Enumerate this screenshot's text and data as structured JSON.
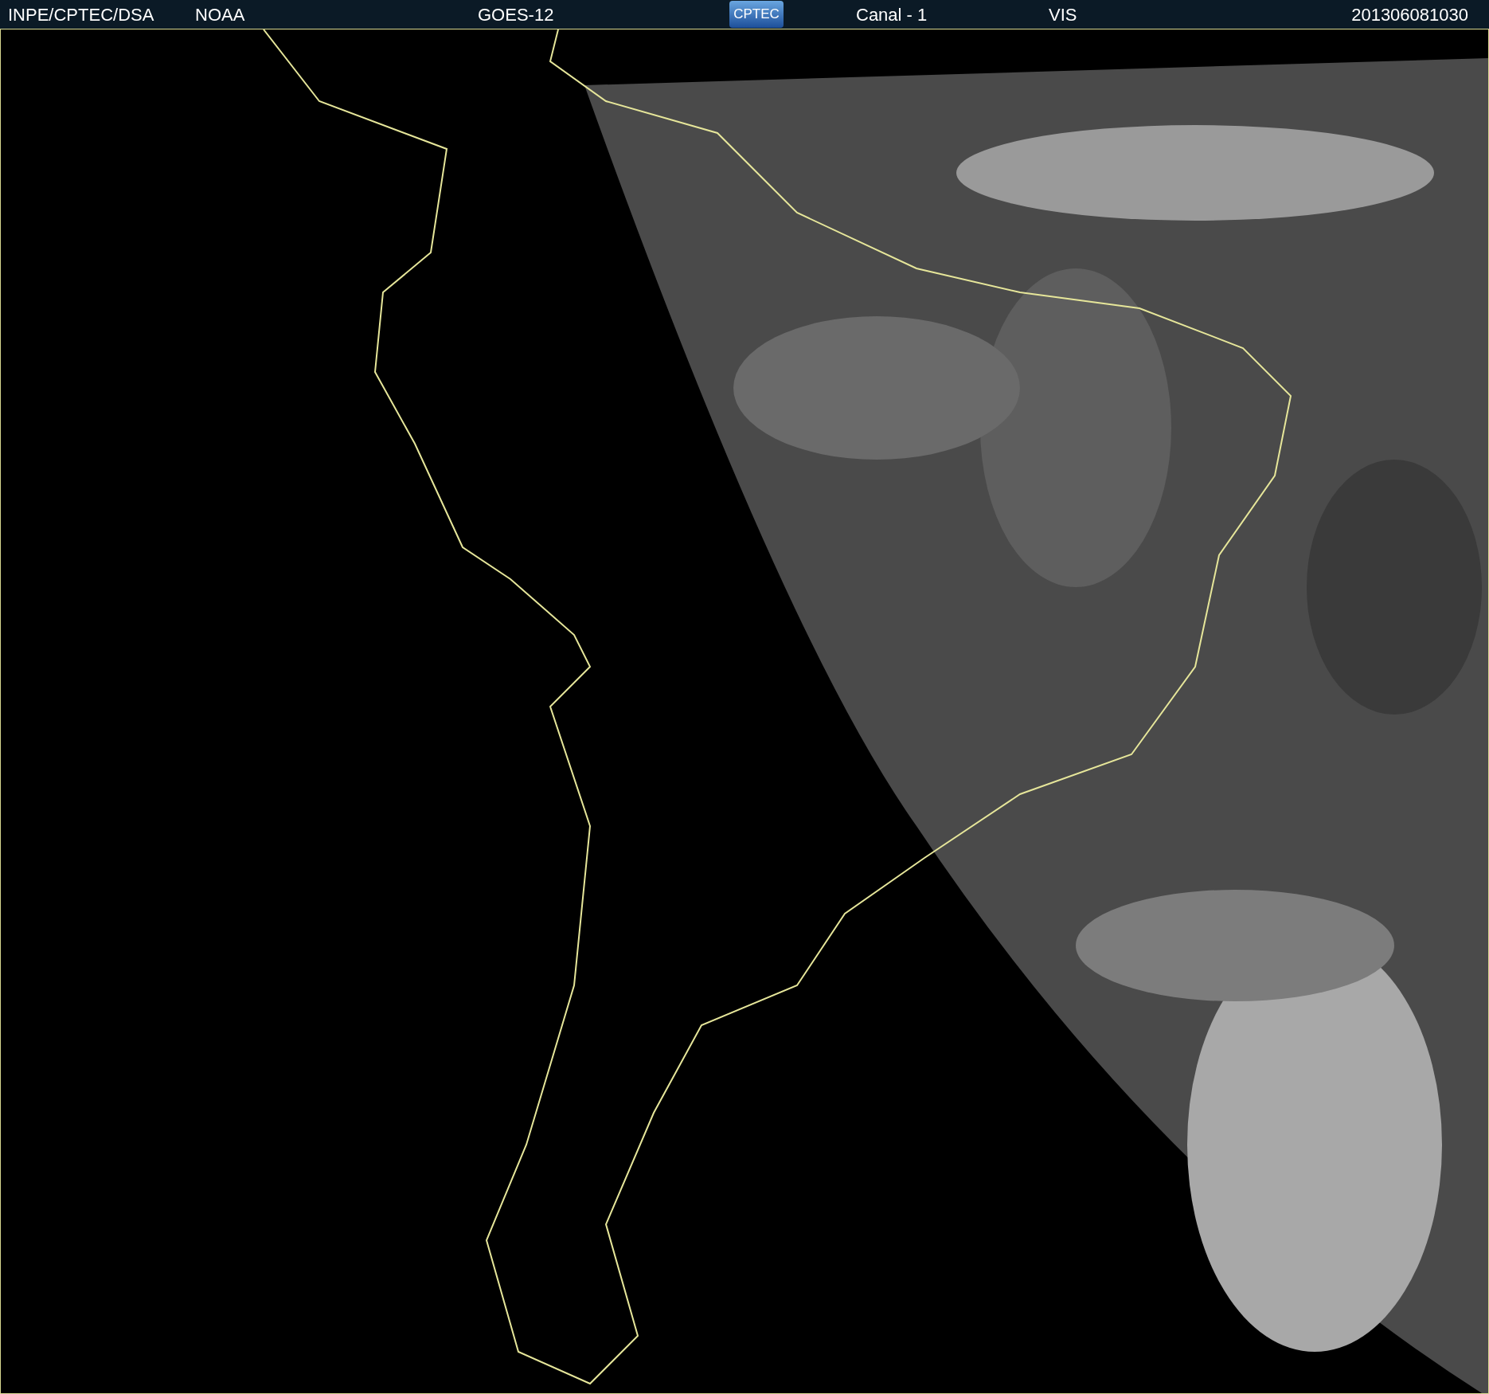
{
  "header": {
    "source": "INPE/CPTEC/DSA",
    "agency": "NOAA",
    "satellite": "GOES-12",
    "logo": "CPTEC",
    "channel": "Canal - 1",
    "band": "VIS",
    "timestamp": "201306081030"
  }
}
